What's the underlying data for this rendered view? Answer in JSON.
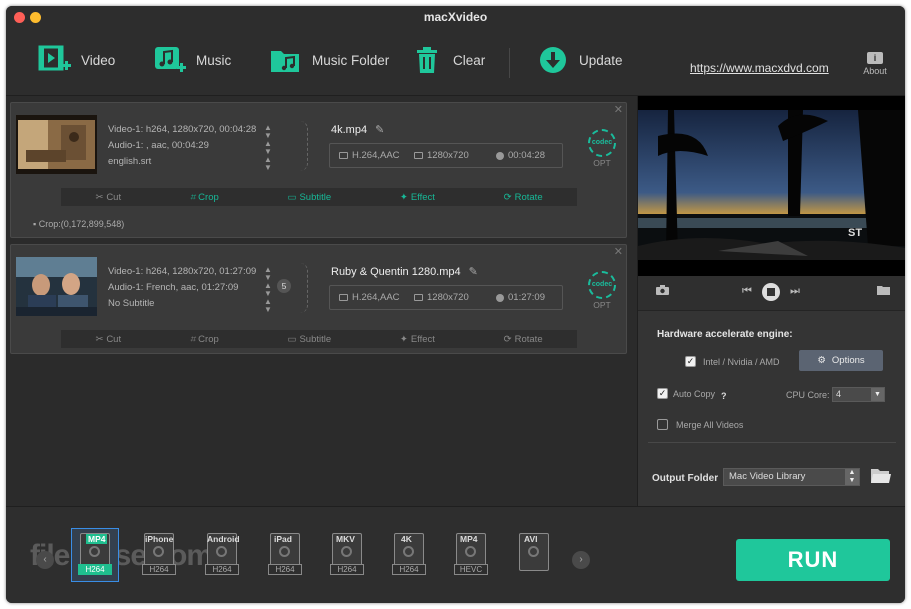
{
  "window": {
    "title": "macXvideo"
  },
  "toolbar": {
    "video": "Video",
    "music": "Music",
    "music_folder": "Music Folder",
    "clear": "Clear",
    "update": "Update",
    "link": "https://www.macxdvd.com",
    "about": "About"
  },
  "items": [
    {
      "video_track": "Video-1: h264, 1280x720, 00:04:28",
      "audio_track": "Audio-1: , aac, 00:04:29",
      "subtitle_track": "english.srt",
      "output_name": "4k.mp4",
      "codec": "H.264,AAC",
      "resolution": "1280x720",
      "duration": "00:04:28",
      "crop_note": "Crop:(0,172,899,548)",
      "badge": ""
    },
    {
      "video_track": "Video-1: h264, 1280x720, 01:27:09",
      "audio_track": "Audio-1: French, aac, 01:27:09",
      "subtitle_track": "No Subtitle",
      "output_name": "Ruby & Quentin 1280.mp4",
      "codec": "H.264,AAC",
      "resolution": "1280x720",
      "duration": "01:27:09",
      "crop_note": "",
      "badge": "5"
    }
  ],
  "actions": {
    "cut": "Cut",
    "crop": "Crop",
    "subtitle": "Subtitle",
    "effect": "Effect",
    "rotate": "Rotate"
  },
  "codec_btn": {
    "top": "codec",
    "bottom": "OPT"
  },
  "settings": {
    "hw_title": "Hardware accelerate engine:",
    "hw_option": "Intel / Nvidia / AMD",
    "options_btn": "Options",
    "auto_copy": "Auto Copy",
    "auto_copy_help": "?",
    "cpu_core_label": "CPU Core:",
    "cpu_core_value": "4",
    "merge_all": "Merge All Videos",
    "output_folder_label": "Output Folder",
    "output_folder_value": "Mac Video Library"
  },
  "formats": [
    {
      "tag": "MP4",
      "sub": "H264",
      "selected": true
    },
    {
      "tag": "iPhone",
      "sub": "H264",
      "selected": false
    },
    {
      "tag": "Android",
      "sub": "H264",
      "selected": false
    },
    {
      "tag": "iPad",
      "sub": "H264",
      "selected": false
    },
    {
      "tag": "MKV",
      "sub": "H264",
      "selected": false
    },
    {
      "tag": "4K",
      "sub": "H264",
      "selected": false
    },
    {
      "tag": "MP4",
      "sub": "HEVC",
      "selected": false
    },
    {
      "tag": "AVI",
      "sub": "",
      "selected": false
    }
  ],
  "run_label": "RUN",
  "watermark": "filehorse.com",
  "colors": {
    "accent": "#1fc79b",
    "select": "#3a8ee6",
    "bg": "#2b2b2b"
  }
}
